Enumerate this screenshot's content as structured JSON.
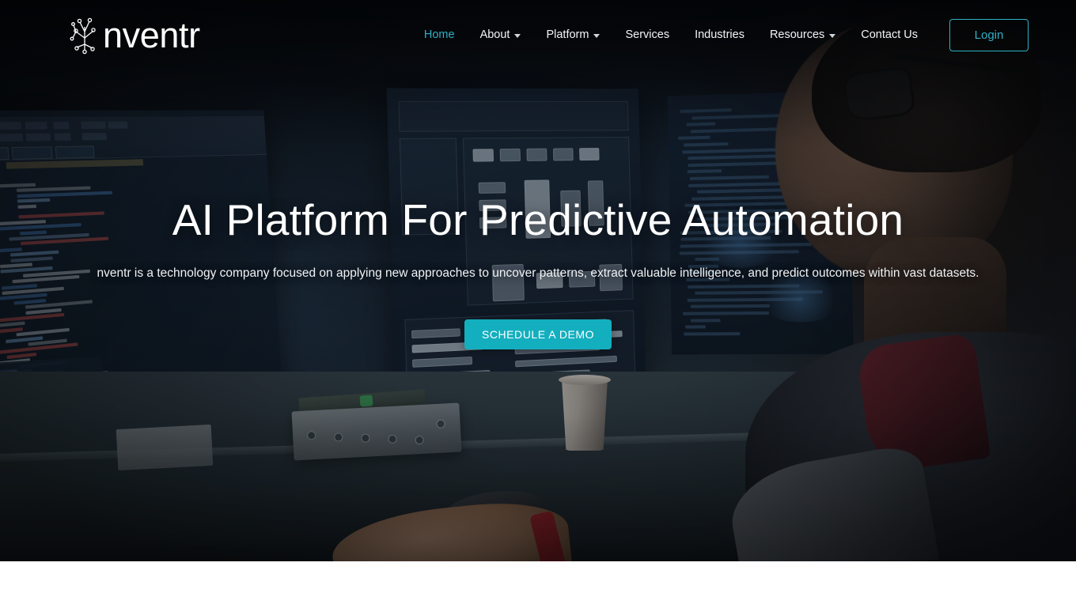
{
  "site": {
    "brand_name": "nventr",
    "brand_logo_icon": "network-node-tree-icon"
  },
  "colors": {
    "accent_teal": "#13afbf",
    "nav_active": "#31b0c4",
    "login_border": "#2bb3c6",
    "text_light": "#ffffff",
    "hero_overlay": "#0a0e13"
  },
  "nav": {
    "items": [
      {
        "label": "Home",
        "active": true,
        "has_dropdown": false
      },
      {
        "label": "About",
        "active": false,
        "has_dropdown": true
      },
      {
        "label": "Platform",
        "active": false,
        "has_dropdown": true
      },
      {
        "label": "Services",
        "active": false,
        "has_dropdown": false
      },
      {
        "label": "Industries",
        "active": false,
        "has_dropdown": false
      },
      {
        "label": "Resources",
        "active": false,
        "has_dropdown": true
      },
      {
        "label": "Contact Us",
        "active": false,
        "has_dropdown": false
      }
    ],
    "login_label": "Login"
  },
  "hero": {
    "title": "AI Platform For Predictive Automation",
    "subtitle": "nventr is a technology company focused on applying new approaches to uncover patterns, extract valuable intelligence, and predict outcomes within vast datasets.",
    "cta_label": "SCHEDULE A DEMO",
    "background_description": "Dark photograph of a bearded man wearing glasses seen in profile from behind, working at a desk with multiple monitors displaying code and data dashboards, a coffee cup and audio interface on the desk"
  }
}
